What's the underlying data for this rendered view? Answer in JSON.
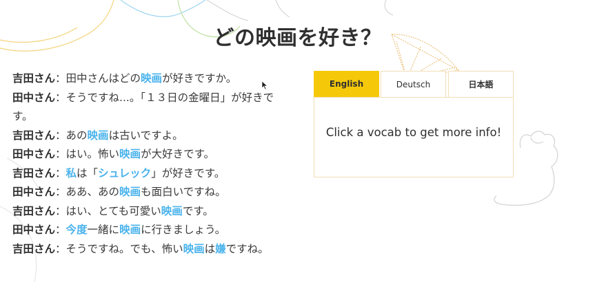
{
  "page": {
    "title": "どの映画を好き？"
  },
  "dialogue": [
    {
      "speaker": "吉田さん",
      "sep": "：",
      "parts": [
        {
          "t": "田中さんはどの"
        },
        {
          "t": "映画",
          "v": true
        },
        {
          "t": "が好きですか。"
        }
      ]
    },
    {
      "speaker": "田中さん",
      "sep": "：",
      "parts": [
        {
          "t": "そうですね...。「１３日の金曜日」が好きです。"
        }
      ]
    },
    {
      "speaker": "吉田さん",
      "sep": "：",
      "parts": [
        {
          "t": "あの"
        },
        {
          "t": "映画",
          "v": true
        },
        {
          "t": "は古いですよ。"
        }
      ]
    },
    {
      "speaker": "田中さん",
      "sep": "：",
      "parts": [
        {
          "t": "はい。怖い"
        },
        {
          "t": "映画",
          "v": true
        },
        {
          "t": "が大好きです。"
        }
      ]
    },
    {
      "speaker": "吉田さん",
      "sep": "：",
      "parts": [
        {
          "t": "私",
          "v": true
        },
        {
          "t": "は「"
        },
        {
          "t": "シュレック",
          "v": true
        },
        {
          "t": "」が好きです。"
        }
      ]
    },
    {
      "speaker": "田中さん",
      "sep": "：",
      "parts": [
        {
          "t": "ああ、あの"
        },
        {
          "t": "映画",
          "v": true
        },
        {
          "t": "も面白いですね。"
        }
      ]
    },
    {
      "speaker": "吉田さん",
      "sep": "：",
      "parts": [
        {
          "t": "はい、とても可愛い"
        },
        {
          "t": "映画",
          "v": true
        },
        {
          "t": "です。"
        }
      ]
    },
    {
      "speaker": "田中さん",
      "sep": "：",
      "parts": [
        {
          "t": "今度",
          "v": true
        },
        {
          "t": "一緒に"
        },
        {
          "t": "映画",
          "v": true
        },
        {
          "t": "に行きましょう。"
        }
      ]
    },
    {
      "speaker": "吉田さん",
      "sep": "：",
      "parts": [
        {
          "t": "そうですね。でも、怖い"
        },
        {
          "t": "映画",
          "v": true
        },
        {
          "t": "は"
        },
        {
          "t": "嫌",
          "v": true
        },
        {
          "t": "ですね。"
        }
      ]
    }
  ],
  "vocab_panel": {
    "tabs": {
      "english": "English",
      "deutsch": "Deutsch",
      "japanese": "日本語"
    },
    "active_tab": "English",
    "message": "Click a vocab to get more info!"
  },
  "colors": {
    "vocab_highlight": "#4ab3ec",
    "active_tab": "#f5c90a",
    "panel_border": "#f0dfb8"
  },
  "icons": {
    "cursor": "mouse-pointer-icon",
    "decoration": "hand-drawn-doodle-icons"
  }
}
